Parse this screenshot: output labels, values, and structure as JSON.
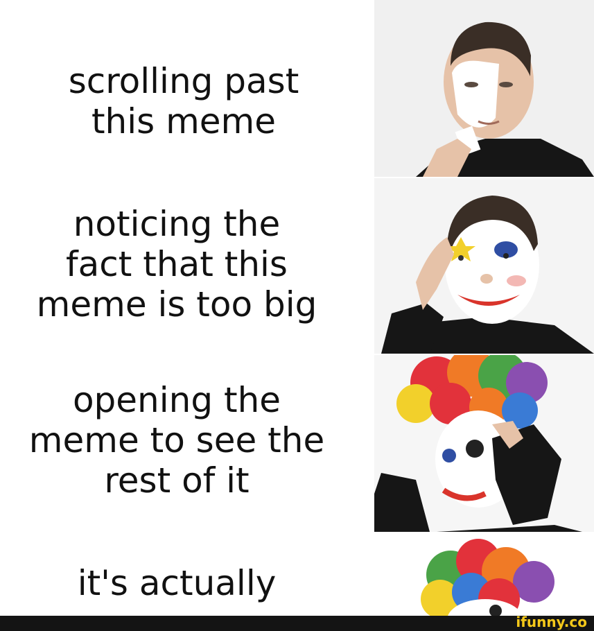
{
  "captions": [
    "scrolling past\nthis meme",
    "noticing the\nfact that this\nmeme is too big",
    "opening the\nmeme to see the\nrest of it",
    "it's actually"
  ],
  "watermark": "ifunny.co",
  "colors": {
    "skin": "#e6c2a8",
    "white_paint": "#ffffff",
    "hair": "#3a2e26",
    "shirt": "#161616",
    "nose_red": "#d9342b",
    "eye_blue": "#2f4ea3",
    "star_yellow": "#f2d02b",
    "watermark_yellow": "#f4c81a"
  }
}
